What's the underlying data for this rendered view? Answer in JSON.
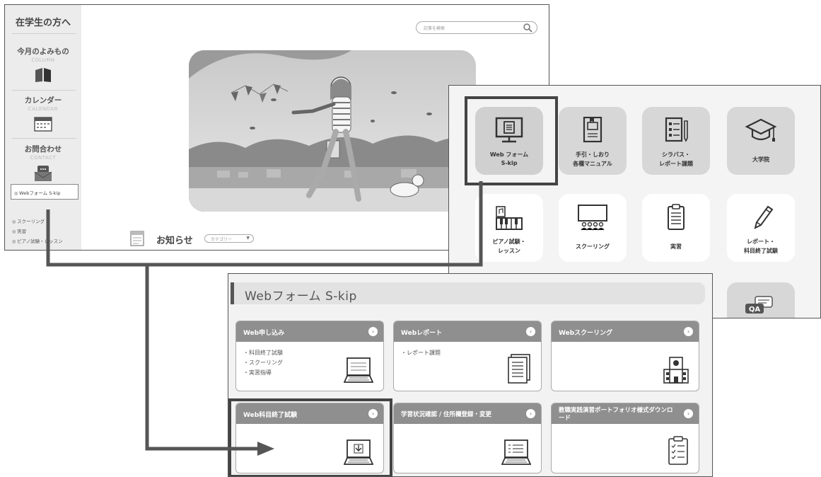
{
  "portal": {
    "sidebar_title": "在学生の方へ",
    "sections": [
      {
        "jp": "今月のよみもの",
        "en": "COLUMN",
        "icon": "book-icon"
      },
      {
        "jp": "カレンダー",
        "en": "CALENDAR",
        "icon": "calendar-icon"
      },
      {
        "jp": "お問合わせ",
        "en": "CONTACT",
        "icon": "contact-icon"
      }
    ],
    "links": [
      "Webフォーム S-kip",
      "スクーリング",
      "実習",
      "ピアノ試験・レッスン"
    ],
    "search_placeholder": "記事を検索",
    "news_title": "お知らせ",
    "category_select": "カテゴリー",
    "category_arrow": "▼"
  },
  "menu_grid": {
    "tiles": [
      {
        "l1": "Web フォーム",
        "l2": "S-kip",
        "icon": "monitor-document-icon",
        "selected": true
      },
      {
        "l1": "手引・しおり",
        "l2": "各種マニュアル",
        "icon": "manual-book-icon"
      },
      {
        "l1": "シラバス・",
        "l2": "レポート課題",
        "icon": "syllabus-icon"
      },
      {
        "l1": "大学院",
        "l2": "",
        "icon": "graduation-cap-icon"
      },
      {
        "l1": "ピアノ試験・",
        "l2": "レッスン",
        "icon": "piano-icon"
      },
      {
        "l1": "スクーリング",
        "l2": "",
        "icon": "classroom-icon"
      },
      {
        "l1": "実習",
        "l2": "",
        "icon": "clipboard-icon"
      },
      {
        "l1": "レポート・",
        "l2": "科目終了試験",
        "icon": "pencil-icon"
      },
      {
        "l1": "QA",
        "l2": "",
        "icon": "qa-icon"
      }
    ]
  },
  "skip": {
    "title": "Webフォーム S-kip",
    "cards": [
      {
        "title": "Web申し込み",
        "items": [
          "科目終了試験",
          "スクーリング",
          "実習指導"
        ],
        "icon": "laptop-icon"
      },
      {
        "title": "Webレポート",
        "items": [
          "レポート課題"
        ],
        "icon": "document-icon"
      },
      {
        "title": "Webスクーリング",
        "items": [],
        "icon": "school-building-icon"
      },
      {
        "title": "Web科目終了試験",
        "items": [],
        "icon": "laptop-download-icon"
      },
      {
        "title": "学習状況確認 / 住所欄登録・変更",
        "items": [],
        "icon": "laptop-list-icon"
      },
      {
        "title": "教職実践演習ポートフォリオ様式ダウンロード",
        "items": [],
        "icon": "checklist-icon"
      }
    ],
    "arrow": "›"
  }
}
